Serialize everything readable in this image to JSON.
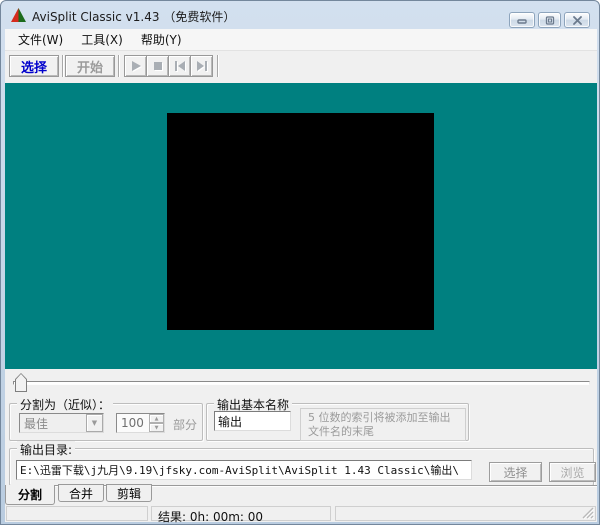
{
  "window": {
    "title": "AviSplit Classic v1.43 （免费软件）",
    "icon": "avisplit-logo",
    "controls": {
      "minimize": "minimize-icon",
      "maximize": "maximize-icon",
      "close": "close-icon"
    }
  },
  "menu": {
    "items": [
      {
        "label": "文件(W)"
      },
      {
        "label": "工具(X)"
      },
      {
        "label": "帮助(Y)"
      }
    ]
  },
  "toolbar": {
    "select_label": "选择",
    "start_label": "开始",
    "playback_icons": [
      "play-icon",
      "stop-icon",
      "go-to-start-icon",
      "go-to-end-icon"
    ]
  },
  "preview": {
    "background_color": "#008080",
    "video_placeholder_color": "#000000"
  },
  "slider": {
    "thumb_position": "start"
  },
  "split_group": {
    "title": "分割为（近似）：",
    "mode_value": "最佳",
    "parts_value": "100",
    "parts_suffix": "部分"
  },
  "output_name_group": {
    "title": "输出基本名称",
    "name_value": "输出",
    "note_line1": "5 位数的索引将被添加至输出",
    "note_line2": "文件名的末尾"
  },
  "output_dir_group": {
    "title": "输出目录:",
    "path_value": "E:\\迅雷下载\\j九月\\9.19\\jfsky.com-AviSplit\\AviSplit 1.43 Classic\\输出\\",
    "select_label": "选择",
    "browse_label": "浏览"
  },
  "tabs": [
    {
      "label": "分割",
      "active": true
    },
    {
      "label": "合并",
      "active": false
    },
    {
      "label": "剪辑",
      "active": false
    }
  ],
  "statusbar": {
    "result_text": "结果: 0h: 00m: 00"
  },
  "colors": {
    "teal": "#008080",
    "accent_blue": "#0000cc",
    "disabled_gray": "#9a9a9a"
  }
}
